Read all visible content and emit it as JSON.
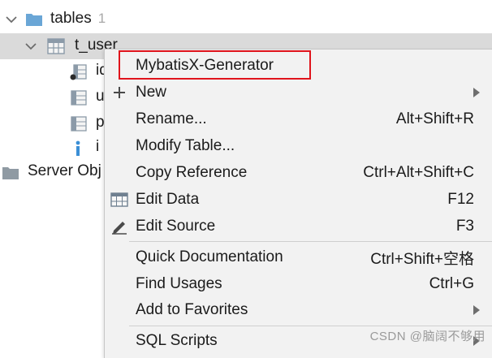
{
  "tree": {
    "tables_label": "tables",
    "tables_count": "1",
    "table_name": "t_user",
    "columns": [
      "id",
      "u",
      "p",
      "i"
    ],
    "server_label": "Server Obj"
  },
  "menu": {
    "items": [
      {
        "label": "MybatisX-Generator",
        "shortcut": "",
        "icon": "none",
        "submenu": false
      },
      {
        "label": "New",
        "shortcut": "",
        "icon": "plus-icon",
        "submenu": true
      },
      {
        "label": "Rename...",
        "shortcut": "Alt+Shift+R",
        "icon": "none",
        "submenu": false
      },
      {
        "label": "Modify Table...",
        "shortcut": "",
        "icon": "none",
        "submenu": false
      },
      {
        "label": "Copy Reference",
        "shortcut": "Ctrl+Alt+Shift+C",
        "icon": "none",
        "submenu": false
      },
      {
        "label": "Edit Data",
        "shortcut": "F12",
        "icon": "table-grid-icon",
        "submenu": false
      },
      {
        "label": "Edit Source",
        "shortcut": "F3",
        "icon": "pencil-icon",
        "submenu": false
      },
      {
        "label": "Quick Documentation",
        "shortcut": "Ctrl+Shift+空格",
        "icon": "none",
        "submenu": false
      },
      {
        "label": "Find Usages",
        "shortcut": "Ctrl+G",
        "icon": "none",
        "submenu": false
      },
      {
        "label": "Add to Favorites",
        "shortcut": "",
        "icon": "none",
        "submenu": true
      },
      {
        "label": "SQL Scripts",
        "shortcut": "",
        "icon": "none",
        "submenu": true
      }
    ]
  },
  "watermark": "CSDN @脑阔不够用",
  "colors": {
    "highlight_box": "#e0141c",
    "selected_row": "#dadada",
    "folder": "#6aa6d6"
  }
}
